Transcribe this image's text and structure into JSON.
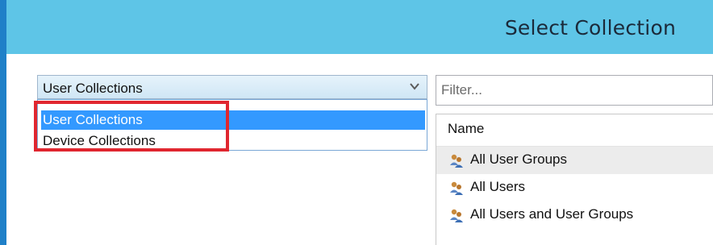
{
  "dialog": {
    "title": "Select Collection"
  },
  "collection_type": {
    "selected": "User Collections",
    "options": [
      "User Collections",
      "Device Collections"
    ],
    "highlighted_option": "User Collections"
  },
  "filter": {
    "placeholder": "Filter..."
  },
  "list": {
    "column_header": "Name",
    "rows": [
      {
        "label": "All User Groups",
        "icon": "user-collection-icon"
      },
      {
        "label": "All Users",
        "icon": "user-collection-icon"
      },
      {
        "label": "All Users and User Groups",
        "icon": "user-collection-icon"
      }
    ]
  },
  "colors": {
    "title_bar": "#5ec5e7",
    "window_frame": "#1f80c8",
    "selection": "#3399ff",
    "annotation_box": "#e0262f"
  }
}
